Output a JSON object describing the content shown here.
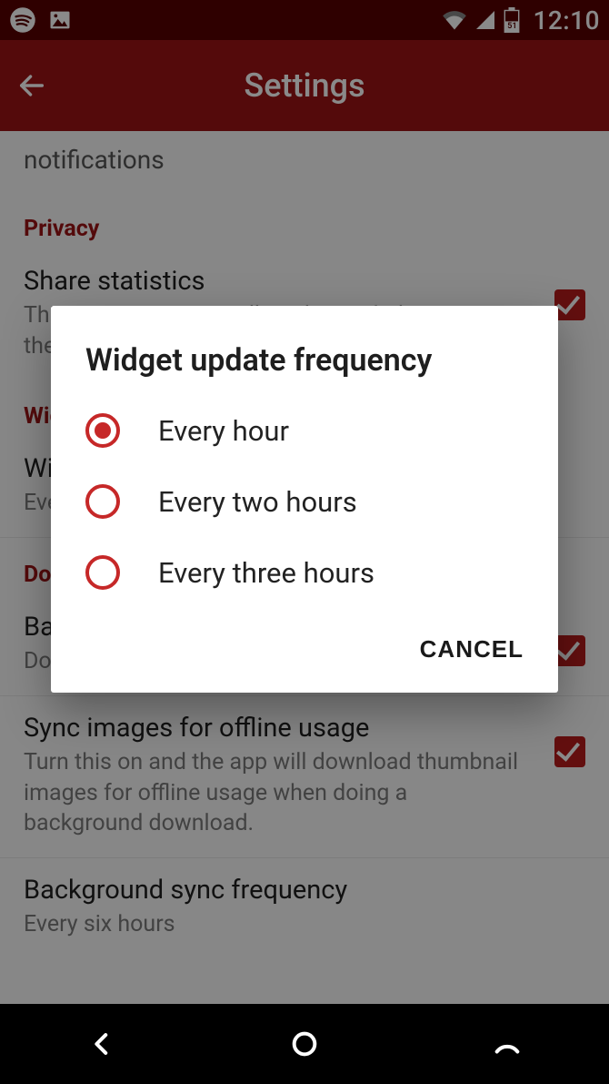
{
  "statusbar": {
    "time": "12:10",
    "battery_text": "51"
  },
  "appbar": {
    "title": "Settings"
  },
  "content": {
    "top_sub_partial": "notifications",
    "privacy_header": "Privacy",
    "share_stats_title": "Share statistics",
    "share_stats_sub": "This means we can collect data to help improve the app. Nothing personal. For full details see our ",
    "widget_header": "Widget",
    "widget_item_title": "Widget update frequency",
    "widget_item_sub": "Every hour",
    "download_header": "Download",
    "bg_sync_title": "Background sync",
    "bg_sync_sub": "Downloads the latest stories in the background",
    "sync_images_title": "Sync images for offline usage",
    "sync_images_sub": "Turn this on and the app will download thumbnail images for offline usage when doing a background download.",
    "bg_freq_title": "Background sync frequency",
    "bg_freq_sub": "Every six hours"
  },
  "dialog": {
    "title": "Widget update frequency",
    "options": [
      {
        "label": "Every hour",
        "selected": true
      },
      {
        "label": "Every two hours",
        "selected": false
      },
      {
        "label": "Every three hours",
        "selected": false
      }
    ],
    "cancel": "CANCEL"
  }
}
